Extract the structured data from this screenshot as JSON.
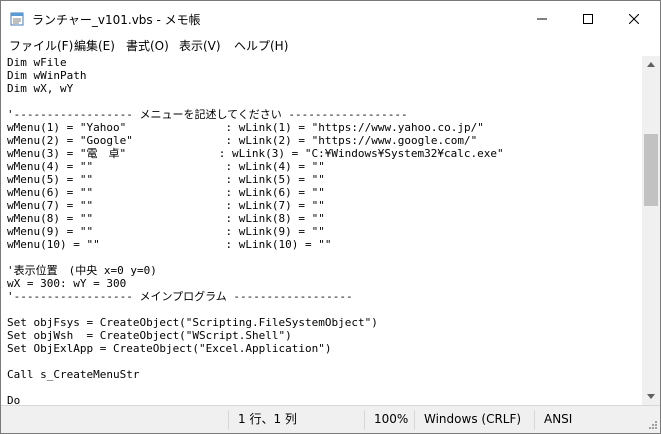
{
  "window": {
    "title": "ランチャー_v101.vbs - メモ帳"
  },
  "menubar": {
    "items": [
      "ファイル(F)",
      "編集(E)",
      "書式(O)",
      "表示(V)",
      "ヘルプ(H)"
    ]
  },
  "editor": {
    "lines": [
      "Dim wFile",
      "Dim wWinPath",
      "Dim wX, wY",
      "",
      "'------------------ メニューを記述してください ------------------",
      "wMenu(1) = \"Yahoo\"               : wLink(1) = \"https://www.yahoo.co.jp/\"",
      "wMenu(2) = \"Google\"              : wLink(2) = \"https://www.google.com/\"",
      "wMenu(3) = \"電　卓\"              : wLink(3) = \"C:¥Windows¥System32¥calc.exe\"",
      "wMenu(4) = \"\"                    : wLink(4) = \"\"",
      "wMenu(5) = \"\"                    : wLink(5) = \"\"",
      "wMenu(6) = \"\"                    : wLink(6) = \"\"",
      "wMenu(7) = \"\"                    : wLink(7) = \"\"",
      "wMenu(8) = \"\"                    : wLink(8) = \"\"",
      "wMenu(9) = \"\"                    : wLink(9) = \"\"",
      "wMenu(10) = \"\"                   : wLink(10) = \"\"",
      "",
      "'表示位置　(中央 x=0 y=0)",
      "wX = 300: wY = 300",
      "'------------------ メインプログラム ------------------",
      "",
      "Set objFsys = CreateObject(\"Scripting.FileSystemObject\")",
      "Set objWsh  = CreateObject(\"WScript.Shell\")",
      "Set ObjExlApp = CreateObject(\"Excel.Application\")",
      "",
      "Call s_CreateMenuStr",
      "",
      "Do"
    ]
  },
  "statusbar": {
    "position": "1 行、1 列",
    "zoom": "100%",
    "line_ending": "Windows (CRLF)",
    "encoding": "ANSI"
  },
  "icons": {
    "app": "notepad-icon",
    "minimize": "minimize-icon",
    "maximize": "maximize-icon",
    "close": "close-icon",
    "scroll_up": "scroll-up-arrow-icon",
    "scroll_down": "scroll-down-arrow-icon",
    "resize": "resize-grip-icon"
  },
  "colors": {
    "statusbar_bg": "#f0f0f0",
    "scrollbar_thumb": "#c2c2c2",
    "text": "#000000"
  }
}
